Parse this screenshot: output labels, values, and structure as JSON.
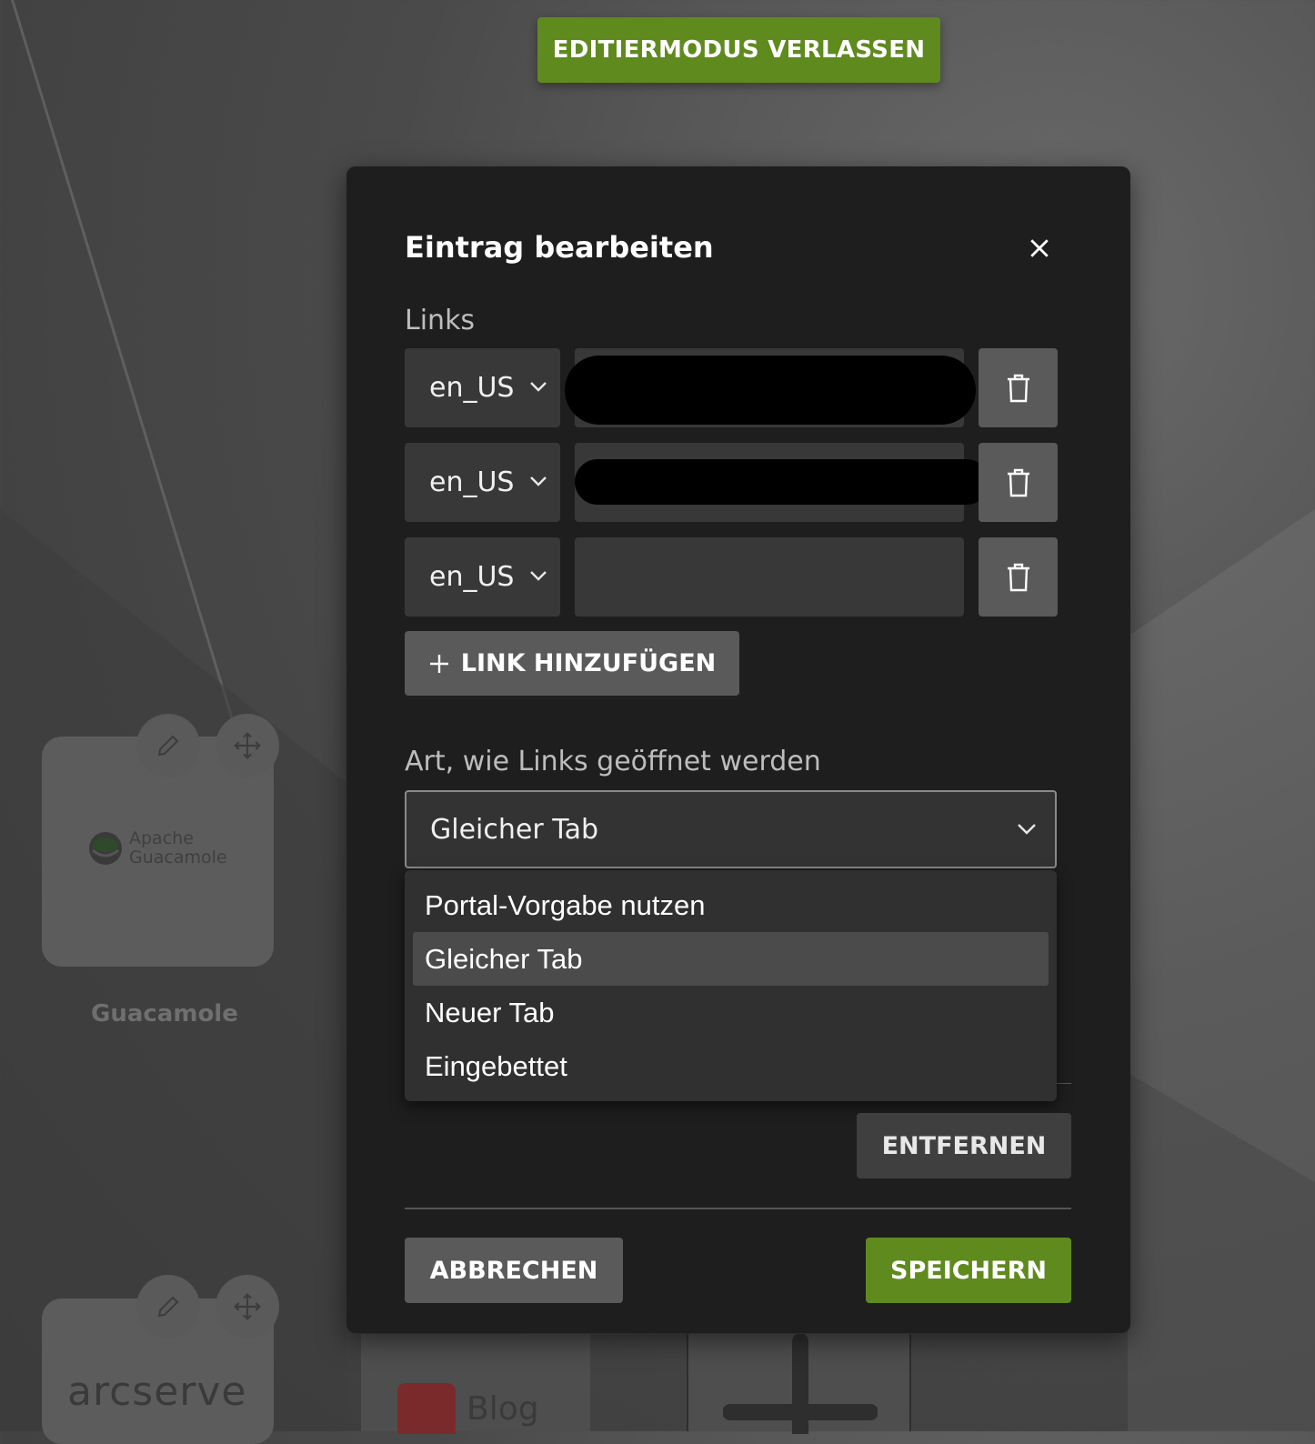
{
  "toolbar": {
    "exit_edit_mode_label": "EDITIERMODUS VERLASSEN"
  },
  "background_tiles": {
    "guacamole": {
      "logo_line1": "Apache",
      "logo_line2": "Guacamole",
      "label": "Guacamole"
    },
    "arcserve": {
      "logo_text": "arcserve"
    },
    "blog": {
      "text": "Blog"
    }
  },
  "modal": {
    "title": "Eintrag bearbeiten",
    "links_label": "Links",
    "links": [
      {
        "language": "en_US",
        "value": "",
        "redacted": true
      },
      {
        "language": "en_US",
        "value": "",
        "redacted": true
      },
      {
        "language": "en_US",
        "value": "",
        "redacted": false
      }
    ],
    "add_link_label": "LINK HINZUFÜGEN",
    "open_mode_label": "Art, wie Links geöffnet werden",
    "open_mode_selected": "Gleicher Tab",
    "open_mode_options": [
      "Portal-Vorgabe nutzen",
      "Gleicher Tab",
      "Neuer Tab",
      "Eingebettet"
    ],
    "remove_label": "ENTFERNEN",
    "cancel_label": "ABBRECHEN",
    "save_label": "SPEICHERN"
  },
  "colors": {
    "accent_green": "#5f8a1e",
    "modal_bg": "#1e1e1e",
    "input_bg": "#383838",
    "button_gray": "#5a5a5a"
  },
  "icons": [
    "pencil-icon",
    "move-icon",
    "close-icon",
    "chevron-down-icon",
    "trash-icon",
    "plus-icon"
  ]
}
